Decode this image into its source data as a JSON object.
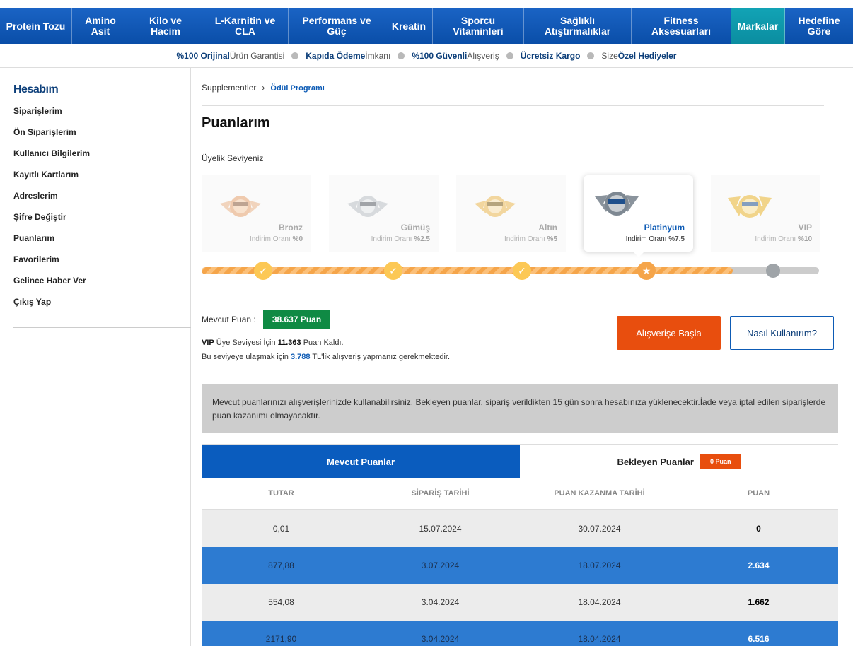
{
  "nav": [
    {
      "label": "Protein Tozu"
    },
    {
      "label": "Amino Asit"
    },
    {
      "label": "Kilo ve Hacim"
    },
    {
      "label": "L-Karnitin ve CLA"
    },
    {
      "label": "Performans ve Güç"
    },
    {
      "label": "Kreatin"
    },
    {
      "label": "Sporcu Vitaminleri"
    },
    {
      "label": "Sağlıklı Atıştırmalıklar"
    },
    {
      "label": "Fitness Aksesuarları"
    },
    {
      "label": "Markalar"
    },
    {
      "label": "Hedefine Göre"
    }
  ],
  "guarantees": [
    {
      "bold": "%100 Orijinal",
      "rest": " Ürün Garantisi"
    },
    {
      "bold": "Kapıda Ödeme",
      "rest": " İmkanı"
    },
    {
      "bold": "%100 Güvenli",
      "rest": " Alışveriş"
    },
    {
      "bold": "Ücretsiz Kargo",
      "rest": ""
    },
    {
      "rest": "Size ",
      "bold": "Özel Hediyeler"
    }
  ],
  "sidebar": {
    "title": "Hesabım",
    "items": [
      "Siparişlerim",
      "Ön Siparişlerim",
      "Kullanıcı Bilgilerim",
      "Kayıtlı Kartlarım",
      "Adreslerim",
      "Şifre Değiştir",
      "Puanlarım",
      "Favorilerim",
      "Gelince Haber Ver",
      "Çıkış Yap"
    ]
  },
  "breadcrumb": {
    "root": "Supplementler",
    "sep": "›",
    "current": "Ödül Programı"
  },
  "page_title": "Puanlarım",
  "level_label": "Üyelik Seviyeniz",
  "levels": [
    {
      "name": "Bronz",
      "rate_label": "İndirim Oranı",
      "rate": "%0",
      "color": "#e3a06d"
    },
    {
      "name": "Gümüş",
      "rate_label": "İndirim Oranı",
      "rate": "%2.5",
      "color": "#b7bcc2"
    },
    {
      "name": "Altın",
      "rate_label": "İndirim Oranı",
      "rate": "%5",
      "color": "#e8b650"
    },
    {
      "name": "Platinyum",
      "rate_label": "İndirim Oranı",
      "rate": "%7.5",
      "color": "#8a939c"
    },
    {
      "name": "VIP",
      "rate_label": "İndirim Oranı",
      "rate": "%10",
      "color": "#e6b22c"
    }
  ],
  "progress_fraction": 0.86,
  "points": {
    "label": "Mevcut Puan :",
    "value": "38.637 Puan",
    "vip_line": {
      "a": "VIP",
      "b": " Üye Seviyesi İçin ",
      "c": "11.363",
      "d": " Puan Kaldı."
    },
    "need_line": {
      "a": "Bu seviyeye ulaşmak için ",
      "b": "3.788",
      "c": " TL'lik alışveriş yapmanız gerekmektedir."
    }
  },
  "buttons": {
    "shop": "Alışverişe Başla",
    "how": "Nasıl Kullanırım?"
  },
  "info": "Mevcut puanlarınızı alışverişlerinizde kullanabilirsiniz. Bekleyen puanlar, sipariş verildikten 15 gün sonra hesabınıza yüklenecektir.İade veya iptal edilen siparişlerde puan kazanımı olmayacaktır.",
  "tabs": {
    "current": "Mevcut Puanlar",
    "pending": "Bekleyen Puanlar",
    "pending_badge": "0 Puan"
  },
  "table": {
    "headers": [
      "TUTAR",
      "SİPARİŞ TARİHİ",
      "PUAN KAZANMA TARİHİ",
      "PUAN"
    ],
    "rows": [
      [
        "0,01",
        "15.07.2024",
        "30.07.2024",
        "0"
      ],
      [
        "877,88",
        "3.07.2024",
        "18.07.2024",
        "2.634"
      ],
      [
        "554,08",
        "3.04.2024",
        "18.04.2024",
        "1.662"
      ],
      [
        "2171,90",
        "3.04.2024",
        "18.04.2024",
        "6.516"
      ]
    ]
  }
}
